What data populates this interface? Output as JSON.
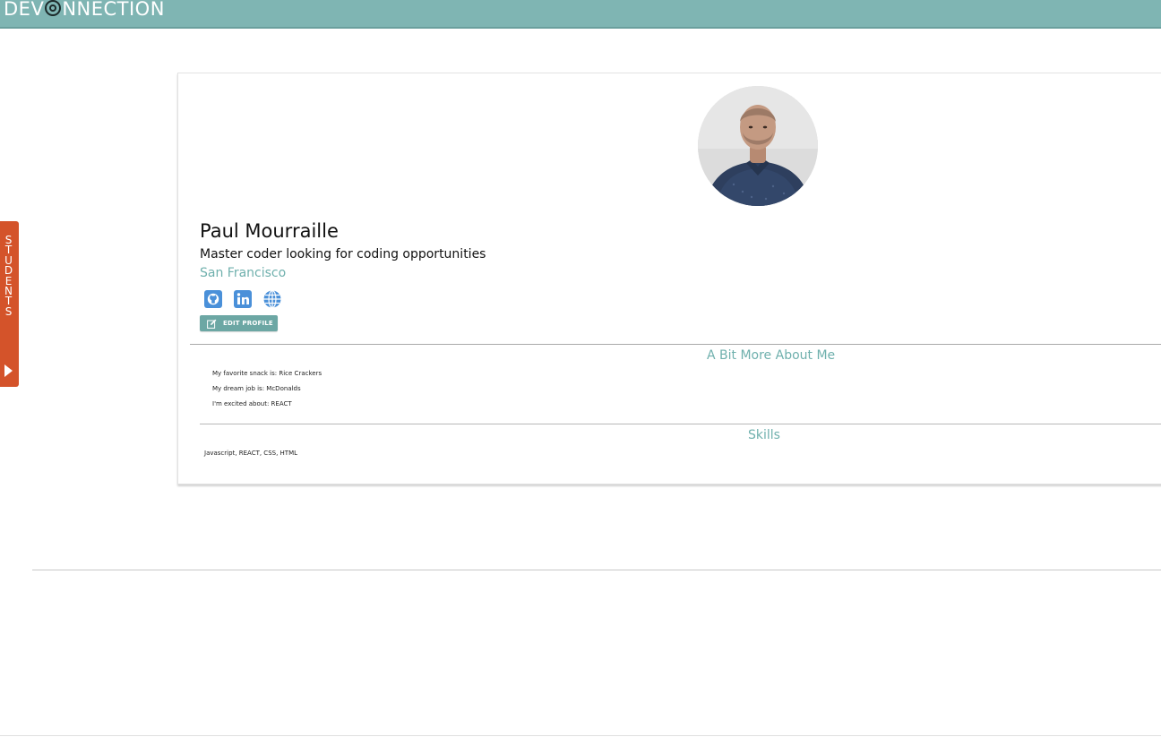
{
  "header": {
    "logo_prefix": "DEV",
    "logo_suffix": "NNECTION",
    "logo_full": "DEVCONNECTION",
    "bar_color": "#7fb5b3"
  },
  "side_tab": {
    "label": "STUDENTS",
    "color": "#d4532a",
    "icon": "caret-right-icon"
  },
  "profile": {
    "avatar_icon": "profile-photo",
    "name": "Paul Mourraille",
    "tagline": "Master coder looking for coding opportunities",
    "location": "San Francisco",
    "socials": [
      {
        "icon": "github-icon"
      },
      {
        "icon": "linkedin-icon"
      },
      {
        "icon": "globe-icon"
      }
    ],
    "edit_button": {
      "label": "EDIT PROFILE",
      "icon": "edit-icon"
    },
    "accent_color": "#6fb0ad",
    "icon_color": "#4a90d9"
  },
  "about": {
    "title": "A Bit More About Me",
    "facts": [
      "My favorite snack is: Rice Crackers",
      "My dream job is: McDonalds",
      "I'm excited about: REACT"
    ]
  },
  "skills": {
    "title": "Skills",
    "text": "Javascript, REACT, CSS, HTML"
  }
}
